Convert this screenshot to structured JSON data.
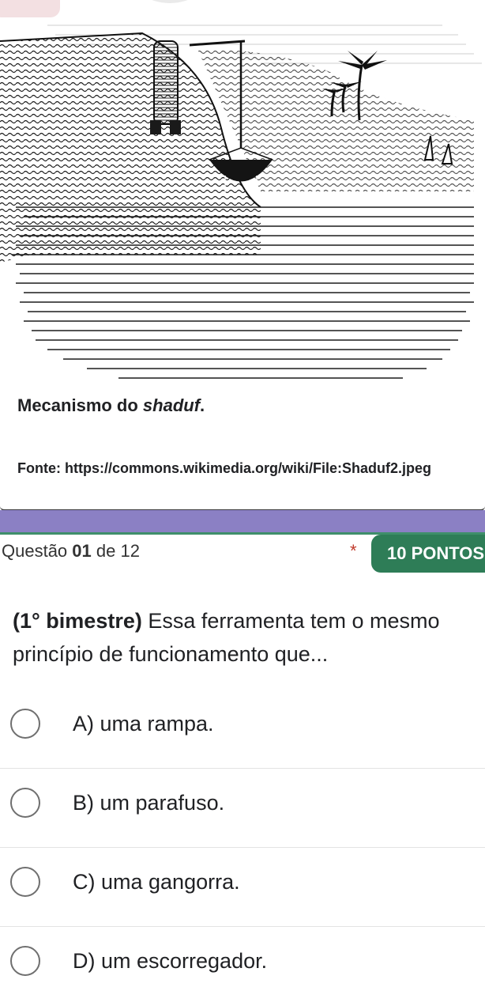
{
  "figure": {
    "caption_prefix": "Mecanismo do ",
    "caption_italic": "shaduf",
    "caption_suffix": ".",
    "source": "Fonte: https://commons.wikimedia.org/wiki/File:Shaduf2.jpeg"
  },
  "question": {
    "label_prefix": "Questão ",
    "number": "01",
    "label_of": " de 12",
    "required_mark": "*",
    "points": "10 PONTOS",
    "text_bold": "(1° bimestre)",
    "text_rest": " Essa ferramenta tem o mesmo princípio de funcionamento que...",
    "options": [
      {
        "label": "A) uma rampa."
      },
      {
        "label": "B) um parafuso."
      },
      {
        "label": "C) uma gangorra."
      },
      {
        "label": "D) um escorregador."
      }
    ]
  },
  "colors": {
    "purple_band": "#8b80c4",
    "green_accent": "#2e7d57",
    "required": "#c03a2b"
  }
}
